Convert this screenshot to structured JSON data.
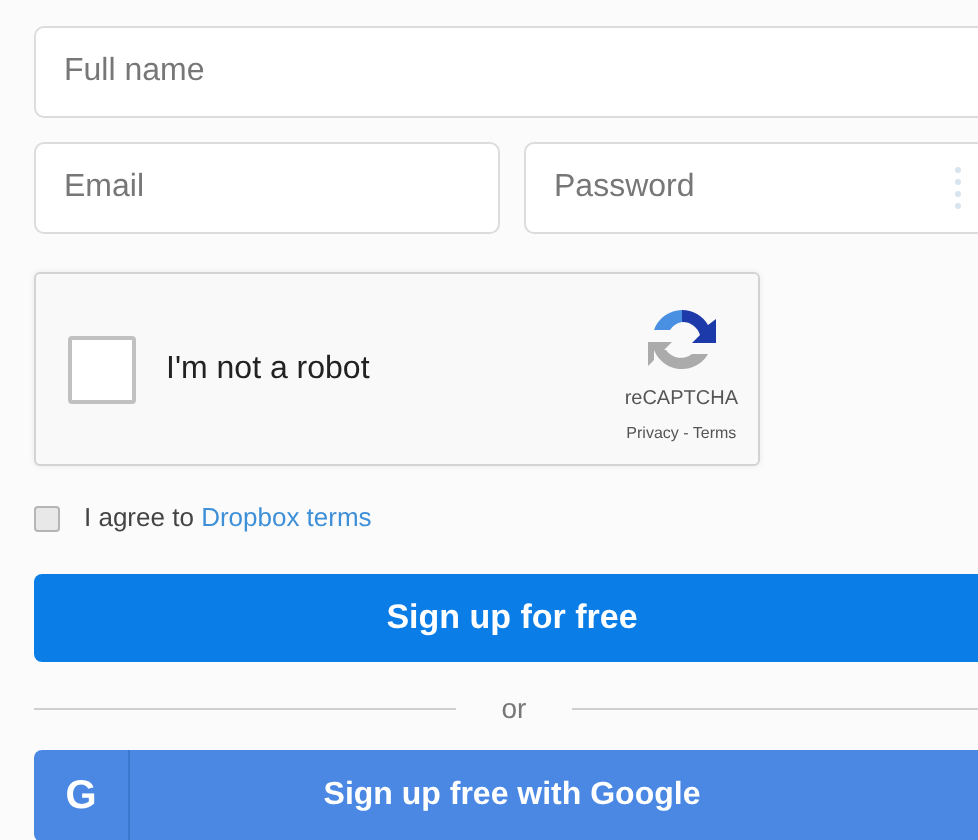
{
  "form": {
    "full_name": {
      "placeholder": "Full name"
    },
    "email": {
      "placeholder": "Email"
    },
    "password": {
      "placeholder": "Password"
    },
    "captcha": {
      "checked": false,
      "label": "I'm not a robot",
      "brand": "reCAPTCHA",
      "links": "Privacy - Terms"
    },
    "agree": {
      "checked": false,
      "text": "I agree to",
      "link": "Dropbox terms"
    },
    "signup_button": "Sign up for free",
    "divider": "or",
    "google_button": {
      "icon": "G",
      "label": "Sign up free with Google"
    }
  }
}
